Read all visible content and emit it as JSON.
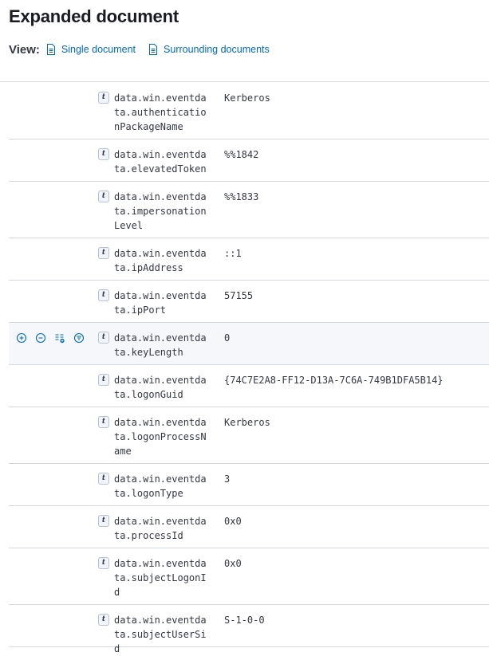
{
  "header": {
    "title": "Expanded document",
    "view_label": "View:",
    "links": [
      "Single document",
      "Surrounding documents"
    ]
  },
  "fields": [
    {
      "name": "data.win.eventdata.authenticationPackageName",
      "value": "Kerberos",
      "type": "t"
    },
    {
      "name": "data.win.eventdata.elevatedToken",
      "value": "%%1842",
      "type": "t"
    },
    {
      "name": "data.win.eventdata.impersonationLevel",
      "value": "%%1833",
      "type": "t"
    },
    {
      "name": "data.win.eventdata.ipAddress",
      "value": "::1",
      "type": "t"
    },
    {
      "name": "data.win.eventdata.ipPort",
      "value": "57155",
      "type": "t"
    },
    {
      "name": "data.win.eventdata.keyLength",
      "value": "0",
      "type": "t",
      "hovered": true
    },
    {
      "name": "data.win.eventdata.logonGuid",
      "value": "{74C7E2A8-FF12-D13A-7C6A-749B1DFA5B14}",
      "type": "t"
    },
    {
      "name": "data.win.eventdata.logonProcessName",
      "value": "Kerberos",
      "type": "t"
    },
    {
      "name": "data.win.eventdata.logonType",
      "value": "3",
      "type": "t"
    },
    {
      "name": "data.win.eventdata.processId",
      "value": "0x0",
      "type": "t"
    },
    {
      "name": "data.win.eventdata.subjectLogonId",
      "value": "0x0",
      "type": "t"
    },
    {
      "name": "data.win.eventdata.subjectUserSid",
      "value": "S-1-0-0",
      "type": "t"
    }
  ],
  "row_actions": [
    "filter-for-value-icon",
    "filter-out-value-icon",
    "toggle-column-icon",
    "filter-exists-icon"
  ],
  "colors": {
    "link": "#006bb8",
    "border": "#d3dae6",
    "text": "#343741",
    "highlight": "#f5f7fa"
  }
}
